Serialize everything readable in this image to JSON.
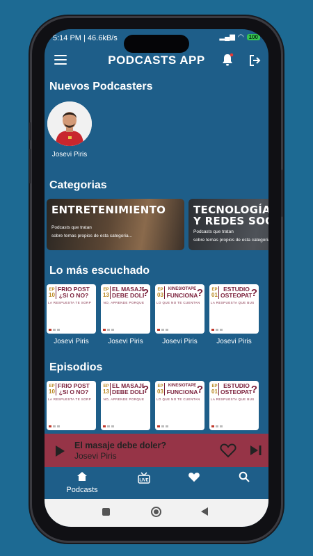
{
  "status_bar": {
    "time_info": "5:14 PM | 46.6kB/s",
    "battery": "100"
  },
  "app_bar": {
    "title": "PODCASTS APP"
  },
  "new_podcasters": {
    "title": "Nuevos Podcasters",
    "items": [
      {
        "name": "Josevi Piris"
      }
    ]
  },
  "categories": {
    "title": "Categorias",
    "items": [
      {
        "title_lines": [
          "ENTRETENIMIENTO"
        ],
        "desc_lines": [
          "Podcasts que tratan",
          "sobre temas propios de esta categoria..."
        ],
        "color": "#4a3a2c"
      },
      {
        "title_lines": [
          "TECNOLOGÍA",
          "Y REDES SOCIAL"
        ],
        "desc_lines": [
          "Podcasts que tratan",
          "sobre temas propios de esta categoria..."
        ],
        "color": "#3c3f44"
      }
    ]
  },
  "most_listened": {
    "title": "Lo más escuchado",
    "items": [
      {
        "ep": "10",
        "title_lines": [
          "FRIO POST LESI",
          "¿SI O NO?"
        ],
        "subtitle": "LA RESPUESTA TE SORPRENDERÁ",
        "author": "Josevi Piris"
      },
      {
        "ep": "13",
        "title_lines": [
          "EL MASAJE",
          "DEBE DOLER"
        ],
        "subtitle": "NO, APRENDE PORQUE",
        "author": "Josevi Piris"
      },
      {
        "ep": "03",
        "title_lines": [
          "KINESIOTAPE",
          "FUNCIONA"
        ],
        "subtitle": "LO QUE NO TE CUENTAN CUENTOS",
        "author": "Josevi Piris"
      },
      {
        "ep": "01",
        "title_lines": [
          "ESTUDIO",
          "OSTEOPATÍA"
        ],
        "subtitle": "LA RESPUESTA QUE BUSCABAS",
        "author": "Josevi Piris"
      }
    ]
  },
  "episodes": {
    "title": "Episodios",
    "items": [
      {
        "ep": "10",
        "title_lines": [
          "FRIO POST LESI",
          "¿SI O NO?"
        ],
        "subtitle": "LA RESPUESTA TE SORPRENDERÁ"
      },
      {
        "ep": "13",
        "title_lines": [
          "EL MASAJE",
          "DEBE DOLER"
        ],
        "subtitle": "NO, APRENDE PORQUE"
      },
      {
        "ep": "03",
        "title_lines": [
          "KINESIOTAPE",
          "FUNCIONA"
        ],
        "subtitle": "LO QUE NO TE CUENTAN CUENTOS"
      },
      {
        "ep": "01",
        "title_lines": [
          "ESTUDIO",
          "OSTEOPATÍA"
        ],
        "subtitle": "LA RESPUESTA QUE BUSCABAS"
      }
    ]
  },
  "player": {
    "title": "El masaje debe doler?",
    "author": "Josevi Piris",
    "icons": [
      "play-icon",
      "heart-icon",
      "skip-next-icon"
    ]
  },
  "bottom_nav": {
    "items": [
      {
        "id": "home",
        "label": "Podcasts",
        "icon": "home-icon",
        "active": true
      },
      {
        "id": "live",
        "label": "",
        "icon": "live-icon",
        "active": false
      },
      {
        "id": "favorites",
        "label": "",
        "icon": "heart-icon",
        "active": false
      },
      {
        "id": "search",
        "label": "",
        "icon": "search-icon",
        "active": false
      }
    ]
  },
  "colors": {
    "background": "#1e5e89",
    "player": "#963447",
    "tile_text": "#7a1f3a"
  }
}
